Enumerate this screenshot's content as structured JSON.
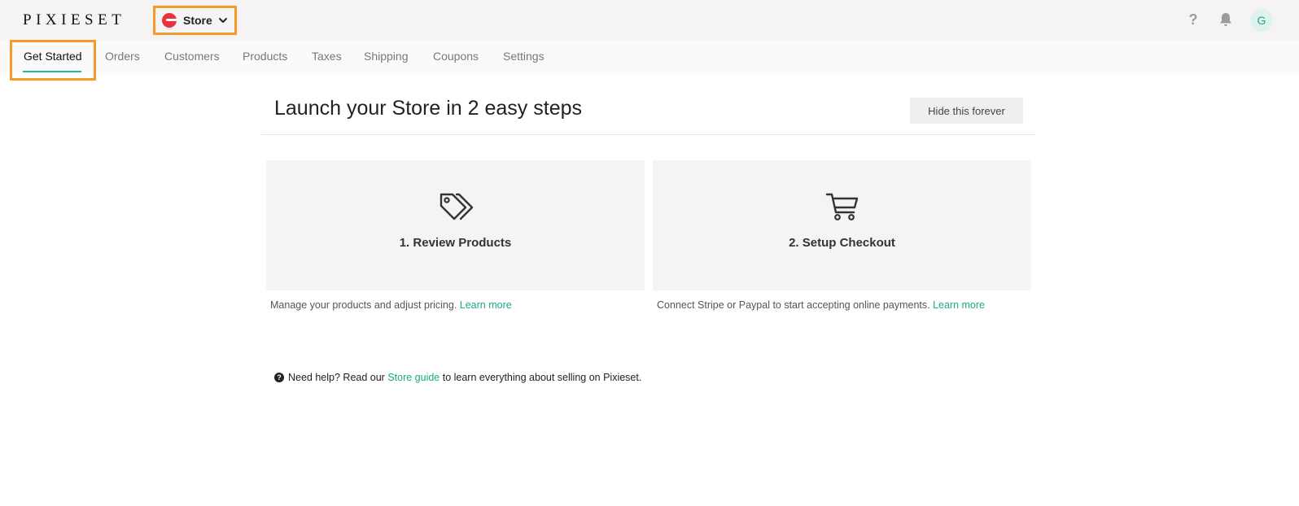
{
  "header": {
    "logo": "PIXIESET",
    "app_switcher": {
      "label": "Store"
    },
    "help_glyph": "?",
    "avatar_initial": "G"
  },
  "tabs": [
    {
      "label": "Get Started",
      "active": true
    },
    {
      "label": "Orders"
    },
    {
      "label": "Customers"
    },
    {
      "label": "Products"
    },
    {
      "label": "Taxes"
    },
    {
      "label": "Shipping"
    },
    {
      "label": "Coupons"
    },
    {
      "label": "Settings"
    }
  ],
  "main": {
    "title": "Launch your Store in 2 easy steps",
    "hide_button": "Hide this forever",
    "steps": [
      {
        "icon": "price-tags-icon",
        "title": "1. Review Products",
        "desc": "Manage your products and adjust pricing. ",
        "link": "Learn more"
      },
      {
        "icon": "shopping-cart-icon",
        "title": "2. Setup Checkout",
        "desc": "Connect Stripe or Paypal to start accepting online payments. ",
        "link": "Learn more"
      }
    ],
    "help": {
      "prefix": "Need help? Read our ",
      "link": "Store guide",
      "suffix": " to learn everything about selling on Pixieset."
    }
  },
  "colors": {
    "accent": "#1aa887",
    "highlight_box": "#f59b2a",
    "store_brand": "#e8343b"
  }
}
